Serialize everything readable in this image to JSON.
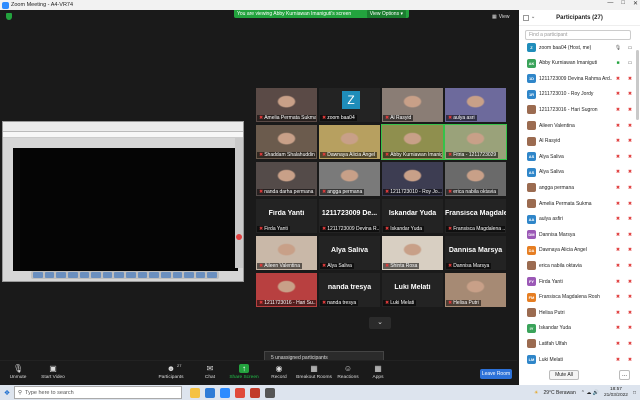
{
  "window": {
    "title": "Zoom Meeting - A4-VR74"
  },
  "banner": {
    "text": "You are viewing Abby Kurniawan Imaniguti's screen",
    "options": "View Options ▾"
  },
  "view_label": "View",
  "grid": {
    "tiles": [
      {
        "name": "Amelia Permata Sukma",
        "kind": "photo",
        "color": "#5a4a46"
      },
      {
        "name": "zoom baa04",
        "kind": "z"
      },
      {
        "name": "Al Rasyid",
        "kind": "photo",
        "color": "#8a7d75"
      },
      {
        "name": "aulya asri",
        "kind": "photo",
        "color": "#6d6a9c"
      },
      {
        "name": "Shaddam Shalahuddin",
        "kind": "photo",
        "color": "#6b5b4d"
      },
      {
        "name": "Dawnaya Alicia Angel",
        "kind": "photo",
        "color": "#b7a060"
      },
      {
        "name": "Abby Kurniawan Imanigut",
        "kind": "photo",
        "color": "#8f8f4e",
        "active": true
      },
      {
        "name": "Fitria - 1211723029",
        "kind": "photo",
        "color": "#9aa27a",
        "active": true
      },
      {
        "name": "nanda darha permana",
        "kind": "photo",
        "color": "#544b49"
      },
      {
        "name": "angga permana",
        "kind": "photo",
        "color": "#7a7a7a"
      },
      {
        "name": "1211723010 - Roy Jo...",
        "kind": "photo",
        "color": "#3d3d52"
      },
      {
        "name": "erica nabila oktavia",
        "kind": "photo",
        "color": "#6a6a6a"
      },
      {
        "name": "Firda Yanti",
        "kind": "text",
        "big": "Firda Yanti"
      },
      {
        "name": "1211723009 Devina R...",
        "kind": "text",
        "big": "1211723009 De..."
      },
      {
        "name": "Iskandar Yuda",
        "kind": "text",
        "big": "Iskandar Yuda"
      },
      {
        "name": "Fransisca Magdalena ...",
        "kind": "text",
        "big": "Fransisca Magdale..."
      },
      {
        "name": "Aileen Valentina",
        "kind": "photo",
        "color": "#c9b8a8"
      },
      {
        "name": "Alya Saliva",
        "kind": "text",
        "big": "Alya Saliva"
      },
      {
        "name": "Shinta Rosa",
        "kind": "photo",
        "color": "#d8cfc2"
      },
      {
        "name": "Dannisa Marsya",
        "kind": "text",
        "big": "Dannisa Marsya"
      },
      {
        "name": "1211723016 - Hari Su...",
        "kind": "photo",
        "color": "#b84040"
      },
      {
        "name": "nanda tresya",
        "kind": "text",
        "big": "nanda tresya"
      },
      {
        "name": "Luki Melati",
        "kind": "text",
        "big": "Luki Melati"
      },
      {
        "name": "Helisa Putri",
        "kind": "photo",
        "color": "#a68a74"
      }
    ]
  },
  "unassigned": "5 unassigned participants",
  "toolbar": {
    "unmute": "Unmute",
    "start_video": "Start Video",
    "participants": "Participants",
    "participants_count": "27",
    "chat": "Chat",
    "share_screen": "Share Screen",
    "record": "Record",
    "breakout": "Breakout Rooms",
    "reactions": "Reactions",
    "apps": "Apps",
    "leave": "Leave Room"
  },
  "panel": {
    "title": "Participants (27)",
    "search_placeholder": "Find a participant",
    "mute_all": "Mute All",
    "more": "...",
    "participants": [
      {
        "name": "zoom baa04 (Host, me)",
        "av": "Z",
        "color": "#1f8dba",
        "mic": "ok",
        "vid": "ok"
      },
      {
        "name": "Abby Kurniawan Imaniguti",
        "av": "AK",
        "color": "#3aa35a",
        "mic": "gr",
        "vid": "ok"
      },
      {
        "name": "1211723009 Devina Rahma Ard...",
        "av": "1D",
        "color": "#2f86c9",
        "mic": "off",
        "vid": "off"
      },
      {
        "name": "1211723010 - Roy Jordy",
        "av": "1R",
        "color": "#2f86c9",
        "mic": "off",
        "vid": "off"
      },
      {
        "name": "1211723016 - Hari Sugron",
        "av": "",
        "color": "img",
        "mic": "off",
        "vid": "off"
      },
      {
        "name": "Aileen Valentina",
        "av": "",
        "color": "img",
        "mic": "off",
        "vid": "off"
      },
      {
        "name": "Al Rasyid",
        "av": "",
        "color": "img",
        "mic": "off",
        "vid": "off"
      },
      {
        "name": "Alya Saliva",
        "av": "AS",
        "color": "#2f86c9",
        "mic": "off",
        "vid": "off"
      },
      {
        "name": "Alya Saliva",
        "av": "AS",
        "color": "#2f86c9",
        "mic": "off",
        "vid": "off"
      },
      {
        "name": "angga permana",
        "av": "",
        "color": "img",
        "mic": "off",
        "vid": "off"
      },
      {
        "name": "Amelia Permata Sukma",
        "av": "",
        "color": "img",
        "mic": "off",
        "vid": "off"
      },
      {
        "name": "aulya asfiri",
        "av": "AA",
        "color": "#2f86c9",
        "mic": "off",
        "vid": "off"
      },
      {
        "name": "Dannisa Marsya",
        "av": "DM",
        "color": "#9b59b6",
        "mic": "off",
        "vid": "off"
      },
      {
        "name": "Dawnaya Alicia Angel",
        "av": "DA",
        "color": "#e67e22",
        "mic": "off",
        "vid": "off"
      },
      {
        "name": "erica nabila oktavia",
        "av": "",
        "color": "img",
        "mic": "off",
        "vid": "off"
      },
      {
        "name": "Firda Yanti",
        "av": "FY",
        "color": "#9b59b6",
        "mic": "off",
        "vid": "off"
      },
      {
        "name": "Fransisca Magdalena Rosh",
        "av": "FM",
        "color": "#e67e22",
        "mic": "off",
        "vid": "off"
      },
      {
        "name": "Helisa Putri",
        "av": "",
        "color": "img",
        "mic": "off",
        "vid": "off"
      },
      {
        "name": "Iskandar Yuda",
        "av": "IY",
        "color": "#3aa35a",
        "mic": "off",
        "vid": "off"
      },
      {
        "name": "Latifah Ulfah",
        "av": "",
        "color": "img",
        "mic": "off",
        "vid": "off"
      },
      {
        "name": "Luki Melati",
        "av": "LM",
        "color": "#2f86c9",
        "mic": "off",
        "vid": "off"
      }
    ]
  },
  "taskbar": {
    "search": "Type here to search",
    "weather": "29°C  Berawan",
    "time": "18:57",
    "date": "21/03/2022"
  }
}
